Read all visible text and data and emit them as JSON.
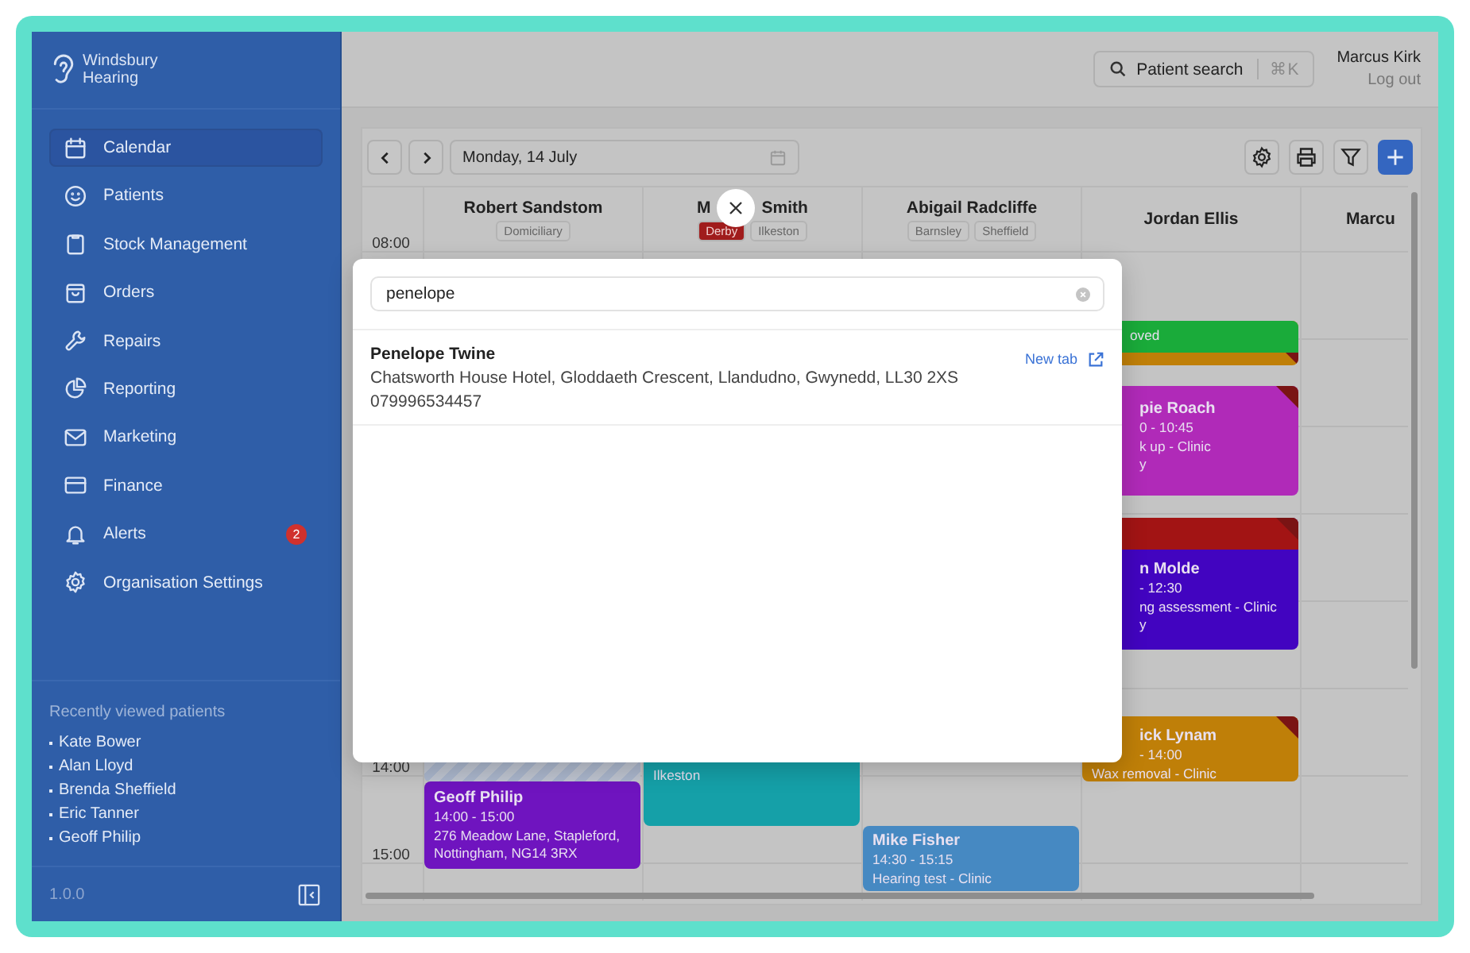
{
  "sidebar": {
    "logo": {
      "line1": "Windsbury",
      "line2": "Hearing"
    },
    "items": [
      {
        "label": "Calendar",
        "selected": true
      },
      {
        "label": "Patients",
        "selected": false
      },
      {
        "label": "Stock Management",
        "selected": false
      },
      {
        "label": "Orders",
        "selected": false
      },
      {
        "label": "Repairs",
        "selected": false
      },
      {
        "label": "Reporting",
        "selected": false
      },
      {
        "label": "Marketing",
        "selected": false
      },
      {
        "label": "Finance",
        "selected": false
      },
      {
        "label": "Alerts",
        "selected": false,
        "badge": "2"
      },
      {
        "label": "Organisation Settings",
        "selected": false
      }
    ],
    "recent": {
      "title": "Recently viewed patients",
      "patients": [
        "Kate Bower",
        "Alan Lloyd",
        "Brenda Sheffield",
        "Eric Tanner",
        "Geoff Philip"
      ]
    },
    "version": "1.0.0"
  },
  "topbar": {
    "search": {
      "label": "Patient search",
      "shortcut": "⌘K"
    },
    "user": {
      "name": "Marcus Kirk",
      "logout": "Log out"
    }
  },
  "calendar": {
    "date": "Monday, 14 July",
    "times": [
      "08:00",
      "14:00",
      "15:00"
    ],
    "columns": [
      {
        "name": "Robert Sandstom",
        "tags": [
          {
            "label": "Domiciliary",
            "color": "#c6c6c6"
          }
        ],
        "events": [
          {
            "kind": "blocked"
          },
          {
            "kind": "appointment",
            "color": "#6f14bf",
            "lines": [
              {
                "text": "Geoff Philip",
                "bold": true,
                "covered": false
              },
              {
                "text": "14:00 - 15:00",
                "bold": false,
                "covered": false
              },
              {
                "text": "276 Meadow Lane, Stapleford,",
                "bold": false,
                "covered": false
              },
              {
                "text": "Nottingham, NG14 3RX",
                "bold": false,
                "covered": false
              }
            ]
          }
        ]
      },
      {
        "name": "M",
        "name_after_cover": "Smith",
        "tags": [
          {
            "label": "Derby",
            "color": "#a01c1c"
          },
          {
            "label": "Ilkeston",
            "color": "#c6c6c6"
          }
        ],
        "events": [
          {
            "kind": "appointment",
            "color": "#15a0a8",
            "lines": [
              {
                "text": "Ilkeston",
                "bold": false,
                "covered": false
              }
            ]
          }
        ]
      },
      {
        "name": "Abigail Radcliffe",
        "tags": [
          {
            "label": "Barnsley",
            "color": "#c6c6c6"
          },
          {
            "label": "Sheffield",
            "color": "#c6c6c6"
          }
        ],
        "events": [
          {
            "kind": "appointment",
            "color": "#4689c2",
            "lines": [
              {
                "text": "Mike Fisher",
                "bold": true,
                "covered": false
              },
              {
                "text": "14:30 - 15:15",
                "bold": false,
                "covered": false
              },
              {
                "text": "Hearing test - Clinic",
                "bold": false,
                "covered": false
              }
            ]
          }
        ]
      },
      {
        "name": "Jordan Ellis",
        "events": [
          {
            "kind": "appointment",
            "color": "#bf7f08",
            "header": {
              "color": "#1aab3a",
              "text": "oved"
            },
            "corner": true
          },
          {
            "kind": "appointment",
            "color": "#b02ab8",
            "corner": true,
            "lines": [
              {
                "text": "pie Roach",
                "bold": true,
                "covered": true
              },
              {
                "text": "0 - 10:45",
                "bold": false,
                "covered": true
              },
              {
                "text": "k up - Clinic",
                "bold": false,
                "covered": true
              },
              {
                "text": "y",
                "bold": false,
                "covered": true
              }
            ]
          },
          {
            "kind": "appointment",
            "color": "#4204c0",
            "header": {
              "color": "#a21414"
            },
            "corner": true,
            "lines": [
              {
                "text": "n Molde",
                "bold": true,
                "covered": true
              },
              {
                "text": "- 12:30",
                "bold": false,
                "covered": true
              },
              {
                "text": "ng assessment - Clinic",
                "bold": false,
                "covered": true
              },
              {
                "text": "y",
                "bold": false,
                "covered": true
              }
            ]
          },
          {
            "kind": "appointment",
            "color": "#bf7f08",
            "corner": true,
            "lines": [
              {
                "text": "ick Lynam",
                "bold": true,
                "covered": true
              },
              {
                "text": "- 14:00",
                "bold": false,
                "covered": true
              },
              {
                "text": "Wax removal - Clinic",
                "bold": false,
                "covered": false
              }
            ]
          }
        ]
      },
      {
        "name": "Marcu"
      }
    ]
  },
  "search_modal": {
    "query": "penelope",
    "results": [
      {
        "name": "Penelope Twine",
        "address": "Chatsworth House Hotel, Gloddaeth Crescent, Llandudno, Gwynedd, LL30 2XS",
        "phone": "079996534457",
        "action": "New tab"
      }
    ]
  }
}
